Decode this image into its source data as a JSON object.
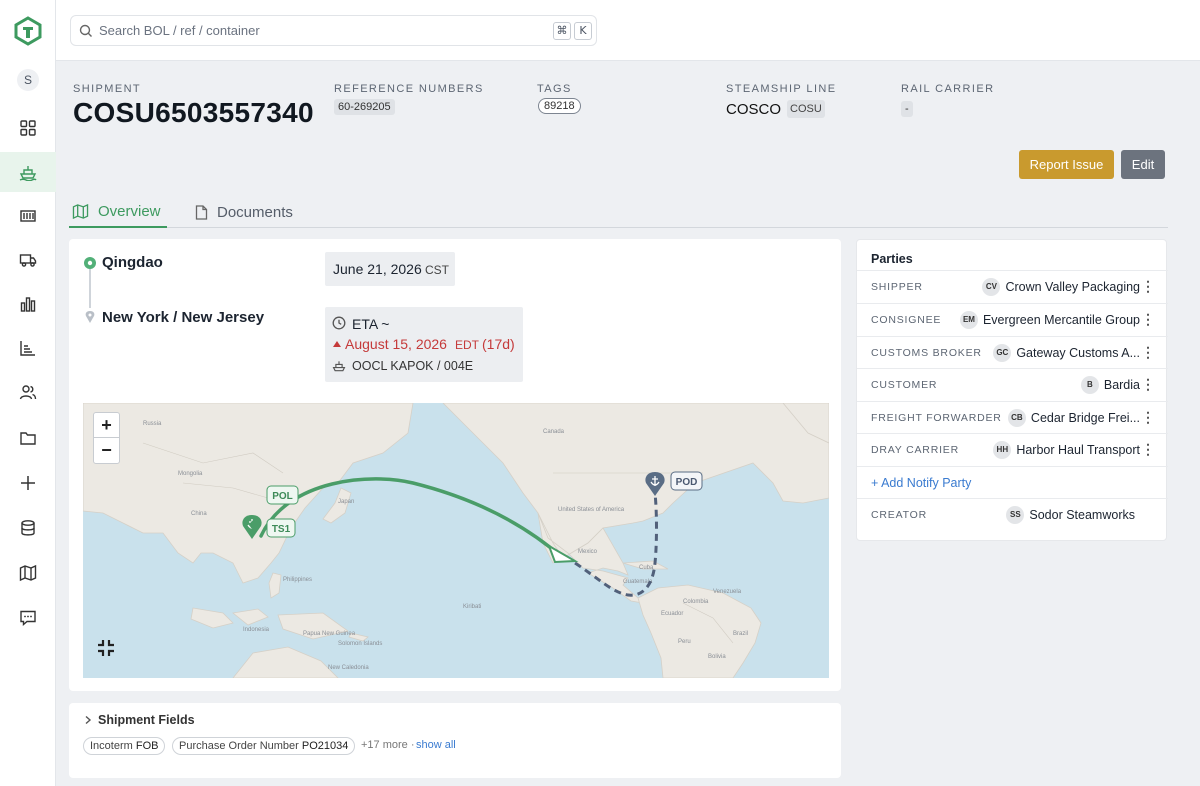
{
  "colors": {
    "brand": "#3d9a5f",
    "report_button": "#c99a2e",
    "edit_button": "#6c737e",
    "delay": "#c53a3a",
    "route_line": "#4a9d68",
    "pod_marker": "#5a6d85",
    "notify_link": "#3a7bd0"
  },
  "sidebar": {
    "avatar_initial": "S",
    "items": [
      {
        "icon": "dashboard-grid-icon"
      },
      {
        "icon": "ship-icon",
        "active": true
      },
      {
        "icon": "container-icon"
      },
      {
        "icon": "truck-icon"
      },
      {
        "icon": "bar-chart-icon"
      },
      {
        "icon": "report-chart-icon"
      },
      {
        "icon": "users-icon"
      },
      {
        "icon": "folder-icon"
      },
      {
        "icon": "plus-icon"
      },
      {
        "icon": "database-icon"
      },
      {
        "icon": "map-icon"
      },
      {
        "icon": "chat-icon"
      }
    ]
  },
  "search": {
    "placeholder": "Search BOL / ref / container",
    "shortcut_mod": "⌘",
    "shortcut_key": "K"
  },
  "header": {
    "shipment_label": "SHIPMENT",
    "shipment_id": "COSU6503557340",
    "reference_label": "REFERENCE NUMBERS",
    "reference_value": "60-269205",
    "tags_label": "TAGS",
    "tag_value": "89218",
    "steamship_label": "STEAMSHIP LINE",
    "steamship_name": "COSCO",
    "steamship_code": "COSU",
    "rail_label": "RAIL CARRIER",
    "rail_value": "-"
  },
  "actions": {
    "report_label": "Report Issue",
    "edit_label": "Edit"
  },
  "tabs": {
    "overview": "Overview",
    "documents": "Documents"
  },
  "route": {
    "origin": "Qingdao",
    "origin_date": "June 21, 2026",
    "origin_tz": "CST",
    "destination": "New York / New Jersey",
    "eta_label": "ETA ~",
    "eta_date": "August 15, 2026",
    "eta_tz": "EDT",
    "eta_delay": "(17d)",
    "vessel": "OOCL KAPOK / 004E"
  },
  "map": {
    "pol_label": "POL",
    "ts_label": "TS1",
    "pod_label": "POD",
    "zoom_in": "+",
    "zoom_out": "−",
    "land_labels": [
      "Canada",
      "United States of America",
      "Mexico",
      "China",
      "Philippines",
      "Indonesia",
      "Russia",
      "Mongolia",
      "Japan",
      "Papua New Guinea",
      "Colombia",
      "Venezuela",
      "Brazil",
      "Peru",
      "Cuba",
      "Solomon Islands",
      "New Caledonia",
      "Kiribati",
      "Guatemala",
      "Ecuador",
      "Bolivia"
    ]
  },
  "parties": {
    "title": "Parties",
    "rows": [
      {
        "label": "SHIPPER",
        "initials": "CV",
        "name": "Crown Valley Packaging"
      },
      {
        "label": "CONSIGNEE",
        "initials": "EM",
        "name": "Evergreen Mercantile Group"
      },
      {
        "label": "CUSTOMS BROKER",
        "initials": "GC",
        "name": "Gateway Customs A..."
      },
      {
        "label": "CUSTOMER",
        "initials": "B",
        "name": "Bardia"
      },
      {
        "label": "FREIGHT FORWARDER",
        "initials": "CB",
        "name": "Cedar Bridge Frei..."
      },
      {
        "label": "DRAY CARRIER",
        "initials": "HH",
        "name": "Harbor Haul Transport"
      }
    ],
    "add_notify": "+ Add Notify Party",
    "creator_label": "CREATOR",
    "creator_initials": "SS",
    "creator_name": "Sodor Steamworks"
  },
  "fields": {
    "title": "Shipment Fields",
    "chip1_label": "Incoterm",
    "chip1_value": "FOB",
    "chip2_label": "Purchase Order Number",
    "chip2_value": "PO21034",
    "more": "+17 more ·",
    "show_all": "show all"
  }
}
